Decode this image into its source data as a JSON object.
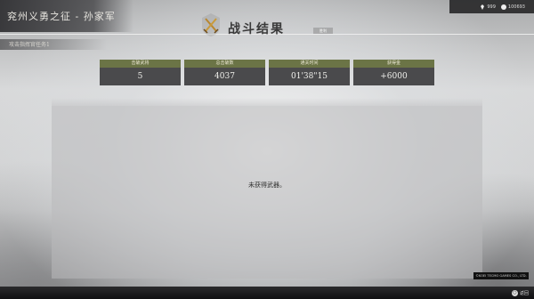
{
  "header": {
    "title": "兖州义勇之征 - 孙家军",
    "subtitle": "攻击指挥官任务1"
  },
  "result": {
    "title": "战斗结果",
    "badge": "胜利",
    "emblem_icon": "crossed-swords-icon"
  },
  "resources": [
    {
      "icon": "gem-icon",
      "value": "999"
    },
    {
      "icon": "coin-icon",
      "value": "100693"
    }
  ],
  "stats": [
    {
      "label": "击破武将",
      "value": "5"
    },
    {
      "label": "总击破数",
      "value": "4037"
    },
    {
      "label": "通关时间",
      "value": "01'38\"15"
    },
    {
      "label": "获得金",
      "value": "+6000"
    }
  ],
  "main": {
    "empty_message": "未获得武器。"
  },
  "footer": {
    "copyright": "©KOEI TECMO GAMES CO., LTD.",
    "back_label": "返回",
    "back_button_glyph": "○"
  },
  "colors": {
    "stat_header": "#6b7446",
    "stat_value_bg": "#4a4a4c",
    "dark_bar": "#222224"
  }
}
